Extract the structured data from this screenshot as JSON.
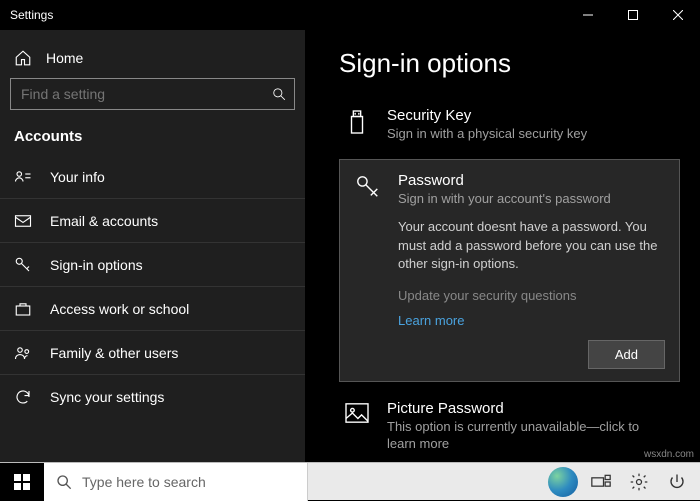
{
  "titlebar": {
    "title": "Settings"
  },
  "sidebar": {
    "home": "Home",
    "search_placeholder": "Find a setting",
    "category": "Accounts",
    "items": [
      {
        "label": "Your info"
      },
      {
        "label": "Email & accounts"
      },
      {
        "label": "Sign-in options"
      },
      {
        "label": "Access work or school"
      },
      {
        "label": "Family & other users"
      },
      {
        "label": "Sync your settings"
      }
    ]
  },
  "main": {
    "title": "Sign-in options",
    "security_key": {
      "title": "Security Key",
      "sub": "Sign in with a physical security key"
    },
    "password": {
      "title": "Password",
      "sub": "Sign in with your account's password",
      "msg": "Your account doesnt have a password. You must add a password before you can use the other sign-in options.",
      "link1": "Update your security questions",
      "link2": "Learn more",
      "add": "Add"
    },
    "picture": {
      "title": "Picture Password",
      "sub": "This option is currently unavailable—click to learn more"
    }
  },
  "taskbar": {
    "search_placeholder": "Type here to search"
  },
  "watermark": "wsxdn.com"
}
